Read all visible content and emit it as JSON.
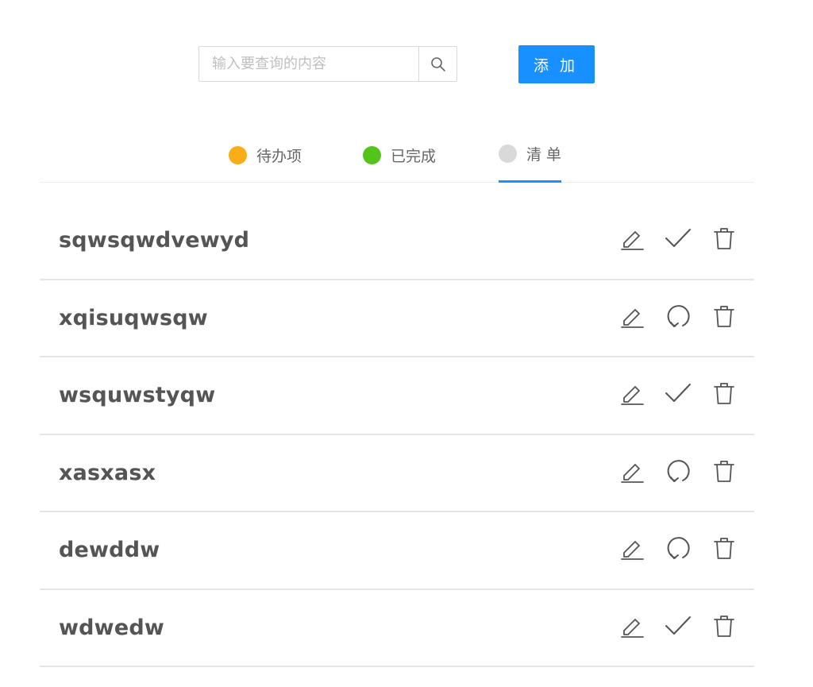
{
  "search": {
    "placeholder": "输入要查询的内容",
    "value": ""
  },
  "add_button": {
    "label": "添 加"
  },
  "tabs": [
    {
      "label": "待办项",
      "color": "#faad14",
      "active": false
    },
    {
      "label": "已完成",
      "color": "#52c41a",
      "active": false
    },
    {
      "label": "清 单",
      "color": "#d9d9d9",
      "active": true
    }
  ],
  "colors": {
    "accent": "#1890ff",
    "text": "#555555",
    "divider": "#e5e5e5"
  },
  "items": [
    {
      "title": "sqwsqwdvewyd",
      "status_icon": "check-icon"
    },
    {
      "title": "xqisuqwsqw",
      "status_icon": "redo-icon"
    },
    {
      "title": "wsquwstyqw",
      "status_icon": "check-icon"
    },
    {
      "title": "xasxasx",
      "status_icon": "redo-icon"
    },
    {
      "title": "dewddw",
      "status_icon": "redo-icon"
    },
    {
      "title": "wdwedw",
      "status_icon": "check-icon"
    }
  ]
}
